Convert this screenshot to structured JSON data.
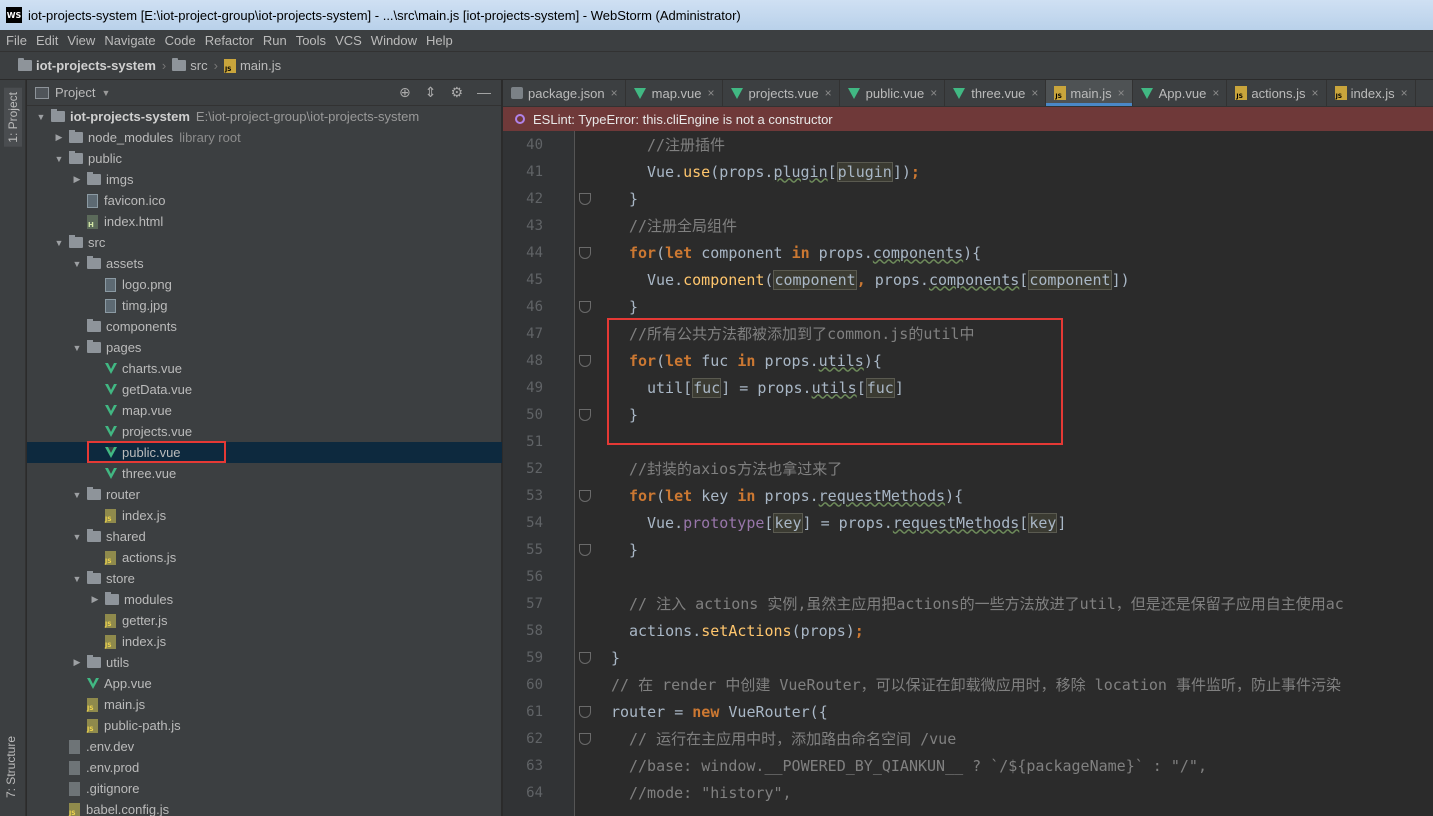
{
  "window": {
    "title": "iot-projects-system [E:\\iot-project-group\\iot-projects-system] - ...\\src\\main.js [iot-projects-system] - WebStorm (Administrator)",
    "logo_text": "WS"
  },
  "menu": [
    "File",
    "Edit",
    "View",
    "Navigate",
    "Code",
    "Refactor",
    "Run",
    "Tools",
    "VCS",
    "Window",
    "Help"
  ],
  "breadcrumb": [
    "iot-projects-system",
    "src",
    "main.js"
  ],
  "left_strip": {
    "project_tab": "1: Project",
    "structure_tab": "7: Structure"
  },
  "project_panel": {
    "title": "Project",
    "tree": [
      {
        "label": "iot-projects-system",
        "extra": "E:\\iot-project-group\\iot-projects-system",
        "kind": "folder",
        "depth": 0,
        "open": true,
        "bold": true
      },
      {
        "label": "node_modules",
        "extra": "library root",
        "kind": "folder",
        "depth": 1,
        "open": false
      },
      {
        "label": "public",
        "kind": "folder",
        "depth": 1,
        "open": true
      },
      {
        "label": "imgs",
        "kind": "folder",
        "depth": 2,
        "open": false
      },
      {
        "label": "favicon.ico",
        "kind": "img",
        "depth": 2
      },
      {
        "label": "index.html",
        "kind": "html",
        "depth": 2
      },
      {
        "label": "src",
        "kind": "folder",
        "depth": 1,
        "open": true
      },
      {
        "label": "assets",
        "kind": "folder",
        "depth": 2,
        "open": true
      },
      {
        "label": "logo.png",
        "kind": "img",
        "depth": 3
      },
      {
        "label": "timg.jpg",
        "kind": "img",
        "depth": 3
      },
      {
        "label": "components",
        "kind": "folder",
        "depth": 2,
        "leaf": true
      },
      {
        "label": "pages",
        "kind": "folder",
        "depth": 2,
        "open": true
      },
      {
        "label": "charts.vue",
        "kind": "vue",
        "depth": 3
      },
      {
        "label": "getData.vue",
        "kind": "vue",
        "depth": 3
      },
      {
        "label": "map.vue",
        "kind": "vue",
        "depth": 3
      },
      {
        "label": "projects.vue",
        "kind": "vue",
        "depth": 3
      },
      {
        "label": "public.vue",
        "kind": "vue",
        "depth": 3,
        "selected": true
      },
      {
        "label": "three.vue",
        "kind": "vue",
        "depth": 3
      },
      {
        "label": "router",
        "kind": "folder",
        "depth": 2,
        "open": true
      },
      {
        "label": "index.js",
        "kind": "js",
        "depth": 3
      },
      {
        "label": "shared",
        "kind": "folder",
        "depth": 2,
        "open": true
      },
      {
        "label": "actions.js",
        "kind": "js",
        "depth": 3
      },
      {
        "label": "store",
        "kind": "folder",
        "depth": 2,
        "open": true
      },
      {
        "label": "modules",
        "kind": "folder",
        "depth": 3,
        "open": false
      },
      {
        "label": "getter.js",
        "kind": "js",
        "depth": 3
      },
      {
        "label": "index.js",
        "kind": "js",
        "depth": 3
      },
      {
        "label": "utils",
        "kind": "folder",
        "depth": 2,
        "open": false
      },
      {
        "label": "App.vue",
        "kind": "vue",
        "depth": 2
      },
      {
        "label": "main.js",
        "kind": "js",
        "depth": 2
      },
      {
        "label": "public-path.js",
        "kind": "js",
        "depth": 2
      },
      {
        "label": ".env.dev",
        "kind": "txt",
        "depth": 1
      },
      {
        "label": ".env.prod",
        "kind": "txt",
        "depth": 1
      },
      {
        "label": ".gitignore",
        "kind": "txt",
        "depth": 1
      },
      {
        "label": "babel.config.js",
        "kind": "js",
        "depth": 1
      }
    ]
  },
  "editor": {
    "tabs": [
      {
        "label": "package.json",
        "icon": "pkg"
      },
      {
        "label": "map.vue",
        "icon": "vue"
      },
      {
        "label": "projects.vue",
        "icon": "vue"
      },
      {
        "label": "public.vue",
        "icon": "vue"
      },
      {
        "label": "three.vue",
        "icon": "vue"
      },
      {
        "label": "main.js",
        "icon": "js",
        "active": true
      },
      {
        "label": "App.vue",
        "icon": "vue"
      },
      {
        "label": "actions.js",
        "icon": "js"
      },
      {
        "label": "index.js",
        "icon": "js"
      }
    ],
    "eslint_message": "ESLint: TypeError: this.cliEngine is not a constructor",
    "lines": [
      {
        "n": "40",
        "indent": 2,
        "fold": false,
        "tokens": [
          [
            "c-com",
            "//注册插件"
          ]
        ]
      },
      {
        "n": "41",
        "indent": 2,
        "fold": false,
        "tokens": [
          [
            "",
            "Vue."
          ],
          [
            "c-fn",
            "use"
          ],
          [
            "",
            "(props."
          ],
          [
            "ul",
            "plugin"
          ],
          [
            "",
            "["
          ],
          [
            "hl",
            "plugin"
          ],
          [
            "",
            "])"
          ],
          [
            "c-kw",
            ";"
          ]
        ]
      },
      {
        "n": "42",
        "indent": 1,
        "fold": true,
        "tokens": [
          [
            "",
            "}"
          ]
        ]
      },
      {
        "n": "43",
        "indent": 1,
        "fold": false,
        "tokens": [
          [
            "c-com",
            "//注册全局组件"
          ]
        ]
      },
      {
        "n": "44",
        "indent": 1,
        "fold": true,
        "tokens": [
          [
            "c-kw",
            "for"
          ],
          [
            "",
            "("
          ],
          [
            "c-kw",
            "let"
          ],
          [
            "",
            " component "
          ],
          [
            "c-kw",
            "in"
          ],
          [
            "",
            " props."
          ],
          [
            "ul",
            "components"
          ],
          [
            "",
            "){"
          ]
        ]
      },
      {
        "n": "45",
        "indent": 2,
        "fold": false,
        "tokens": [
          [
            "",
            "Vue."
          ],
          [
            "c-fn",
            "component"
          ],
          [
            "",
            "("
          ],
          [
            "hl",
            "component"
          ],
          [
            "c-kw",
            ","
          ],
          [
            "",
            " props."
          ],
          [
            "ul",
            "components"
          ],
          [
            "",
            "["
          ],
          [
            "hl",
            "component"
          ],
          [
            "",
            "])"
          ]
        ]
      },
      {
        "n": "46",
        "indent": 1,
        "fold": true,
        "tokens": [
          [
            "",
            "}"
          ]
        ]
      },
      {
        "n": "47",
        "indent": 1,
        "fold": false,
        "tokens": [
          [
            "c-com",
            "//所有公共方法都被添加到了common.js的util中"
          ]
        ]
      },
      {
        "n": "48",
        "indent": 1,
        "fold": true,
        "tokens": [
          [
            "c-kw",
            "for"
          ],
          [
            "",
            "("
          ],
          [
            "c-kw",
            "let"
          ],
          [
            "",
            " fuc "
          ],
          [
            "c-kw",
            "in"
          ],
          [
            "",
            " props."
          ],
          [
            "ul",
            "utils"
          ],
          [
            "",
            "){"
          ]
        ]
      },
      {
        "n": "49",
        "indent": 2,
        "fold": false,
        "tokens": [
          [
            "",
            "util["
          ],
          [
            "hl",
            "fuc"
          ],
          [
            "",
            "] = props."
          ],
          [
            "ul",
            "utils"
          ],
          [
            "",
            "["
          ],
          [
            "hl",
            "fuc"
          ],
          [
            "",
            "]"
          ]
        ]
      },
      {
        "n": "50",
        "indent": 1,
        "fold": true,
        "tokens": [
          [
            "",
            "}"
          ]
        ]
      },
      {
        "n": "51",
        "indent": 0,
        "fold": false,
        "tokens": []
      },
      {
        "n": "52",
        "indent": 1,
        "fold": false,
        "tokens": [
          [
            "c-com",
            "//封装的axios方法也拿过来了"
          ]
        ]
      },
      {
        "n": "53",
        "indent": 1,
        "fold": true,
        "tokens": [
          [
            "c-kw",
            "for"
          ],
          [
            "",
            "("
          ],
          [
            "c-kw",
            "let"
          ],
          [
            "",
            " key "
          ],
          [
            "c-kw",
            "in"
          ],
          [
            "",
            " props."
          ],
          [
            "ul",
            "requestMethods"
          ],
          [
            "",
            "){"
          ]
        ]
      },
      {
        "n": "54",
        "indent": 2,
        "fold": false,
        "tokens": [
          [
            "",
            "Vue."
          ],
          [
            "c-prop",
            "prototype"
          ],
          [
            "",
            "["
          ],
          [
            "hl",
            "key"
          ],
          [
            "",
            "] = props."
          ],
          [
            "ul",
            "requestMethods"
          ],
          [
            "",
            "["
          ],
          [
            "hl",
            "key"
          ],
          [
            "",
            "]"
          ]
        ]
      },
      {
        "n": "55",
        "indent": 1,
        "fold": true,
        "tokens": [
          [
            "",
            "}"
          ]
        ]
      },
      {
        "n": "56",
        "indent": 0,
        "fold": false,
        "tokens": []
      },
      {
        "n": "57",
        "indent": 1,
        "fold": false,
        "tokens": [
          [
            "c-com",
            "// 注入 actions 实例,虽然主应用把actions的一些方法放进了util，但是还是保留子应用自主使用ac"
          ]
        ]
      },
      {
        "n": "58",
        "indent": 1,
        "fold": false,
        "tokens": [
          [
            "",
            "actions."
          ],
          [
            "c-fn",
            "setActions"
          ],
          [
            "",
            "(props)"
          ],
          [
            "c-kw",
            ";"
          ]
        ]
      },
      {
        "n": "59",
        "indent": 0,
        "fold": true,
        "tokens": [
          [
            "",
            "}"
          ]
        ]
      },
      {
        "n": "60",
        "indent": 0,
        "fold": false,
        "tokens": [
          [
            "c-com",
            "// 在 render 中创建 VueRouter，可以保证在卸载微应用时，移除 location 事件监听，防止事件污染"
          ]
        ]
      },
      {
        "n": "61",
        "indent": 0,
        "fold": true,
        "tokens": [
          [
            "",
            "router = "
          ],
          [
            "c-kw",
            "new"
          ],
          [
            "",
            " VueRouter({"
          ]
        ]
      },
      {
        "n": "62",
        "indent": 1,
        "fold": true,
        "tokens": [
          [
            "c-com",
            "// 运行在主应用中时，添加路由命名空间 /vue"
          ]
        ]
      },
      {
        "n": "63",
        "indent": 1,
        "fold": false,
        "tokens": [
          [
            "c-com",
            "//base: window.__POWERED_BY_QIANKUN__ ? `/${packageName}` : \"/\","
          ]
        ]
      },
      {
        "n": "64",
        "indent": 1,
        "fold": false,
        "tokens": [
          [
            "c-com",
            "//mode: \"history\","
          ]
        ]
      }
    ]
  }
}
